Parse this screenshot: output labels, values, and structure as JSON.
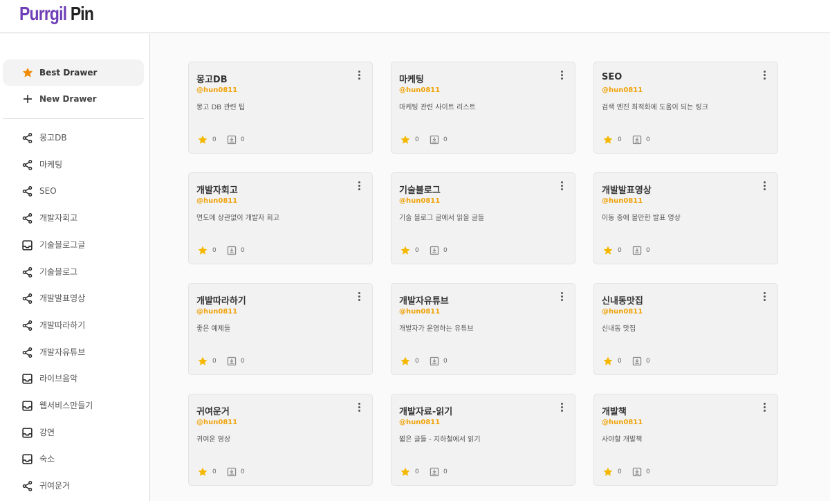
{
  "logo": {
    "part1": "Purrgil",
    "part2": "Pin"
  },
  "sidebar": {
    "best_drawer": "Best Drawer",
    "new_drawer": "New Drawer",
    "items": [
      {
        "label": "몽고DB",
        "icon": "share-icon"
      },
      {
        "label": "마케팅",
        "icon": "share-icon"
      },
      {
        "label": "SEO",
        "icon": "share-icon"
      },
      {
        "label": "개발자회고",
        "icon": "share-icon"
      },
      {
        "label": "기술블로그글",
        "icon": "inbox-icon"
      },
      {
        "label": "기술블로그",
        "icon": "share-icon"
      },
      {
        "label": "개발발표영상",
        "icon": "share-icon"
      },
      {
        "label": "개발따라하기",
        "icon": "share-icon"
      },
      {
        "label": "개발자유튜브",
        "icon": "share-icon"
      },
      {
        "label": "라이브음악",
        "icon": "inbox-icon"
      },
      {
        "label": "웹서비스만들기",
        "icon": "inbox-icon"
      },
      {
        "label": "강연",
        "icon": "inbox-icon"
      },
      {
        "label": "숙소",
        "icon": "inbox-icon"
      },
      {
        "label": "귀여운거",
        "icon": "share-icon"
      }
    ]
  },
  "cards": [
    {
      "title": "몽고DB",
      "author": "@hun0811",
      "desc": "몽고 DB 관련 팁",
      "stars": "0",
      "saves": "0"
    },
    {
      "title": "마케팅",
      "author": "@hun0811",
      "desc": "마케팅 관련 사이트 리스트",
      "stars": "0",
      "saves": "0"
    },
    {
      "title": "SEO",
      "author": "@hun0811",
      "desc": "검색 엔진 최적화에 도움이 되는 링크",
      "stars": "0",
      "saves": "0"
    },
    {
      "title": "개발자회고",
      "author": "@hun0811",
      "desc": "연도에 상관없이 개발자 회고",
      "stars": "0",
      "saves": "0"
    },
    {
      "title": "기술블로그",
      "author": "@hun0811",
      "desc": "기술 블로그 글에서 읽을 글들",
      "stars": "0",
      "saves": "0"
    },
    {
      "title": "개발발표영상",
      "author": "@hun0811",
      "desc": "이동 중에 볼만한 발표 영상",
      "stars": "0",
      "saves": "0"
    },
    {
      "title": "개발따라하기",
      "author": "@hun0811",
      "desc": "좋은 예제들",
      "stars": "0",
      "saves": "0"
    },
    {
      "title": "개발자유튜브",
      "author": "@hun0811",
      "desc": "개발자가 운영하는 유튜브",
      "stars": "0",
      "saves": "0"
    },
    {
      "title": "신내동맛집",
      "author": "@hun0811",
      "desc": "신내동 맛집",
      "stars": "0",
      "saves": "0"
    },
    {
      "title": "귀여운거",
      "author": "@hun0811",
      "desc": "귀여운 영상",
      "stars": "0",
      "saves": "0"
    },
    {
      "title": "개발자료-읽기",
      "author": "@hun0811",
      "desc": "짧은 글들 - 지하철에서 읽기",
      "stars": "0",
      "saves": "0"
    },
    {
      "title": "개발책",
      "author": "@hun0811",
      "desc": "사야할 개발책",
      "stars": "0",
      "saves": "0"
    }
  ],
  "colors": {
    "brand": "#6e3fb6",
    "accent": "#f0a30a",
    "star": "#f5b800"
  }
}
